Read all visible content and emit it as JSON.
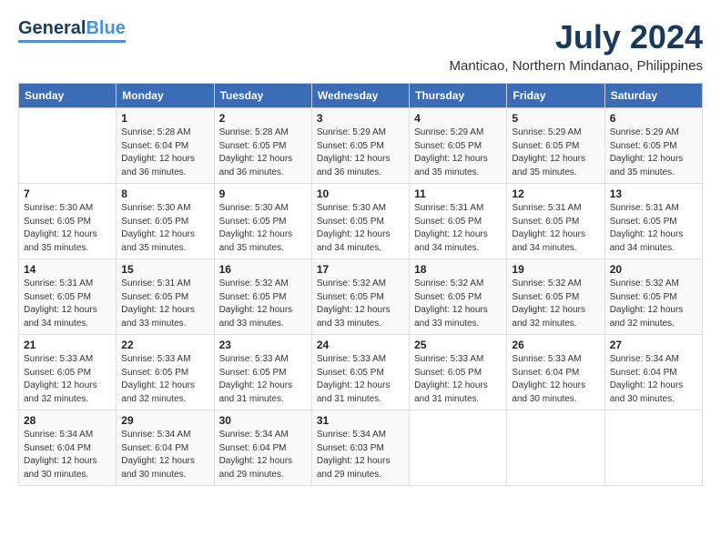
{
  "logo": {
    "general": "General",
    "blue": "Blue"
  },
  "title": {
    "month_year": "July 2024",
    "location": "Manticao, Northern Mindanao, Philippines"
  },
  "header": {
    "days": [
      "Sunday",
      "Monday",
      "Tuesday",
      "Wednesday",
      "Thursday",
      "Friday",
      "Saturday"
    ]
  },
  "weeks": [
    [
      {
        "day": "",
        "sunrise": "",
        "sunset": "",
        "daylight": ""
      },
      {
        "day": "1",
        "sunrise": "Sunrise: 5:28 AM",
        "sunset": "Sunset: 6:04 PM",
        "daylight": "Daylight: 12 hours and 36 minutes."
      },
      {
        "day": "2",
        "sunrise": "Sunrise: 5:28 AM",
        "sunset": "Sunset: 6:05 PM",
        "daylight": "Daylight: 12 hours and 36 minutes."
      },
      {
        "day": "3",
        "sunrise": "Sunrise: 5:29 AM",
        "sunset": "Sunset: 6:05 PM",
        "daylight": "Daylight: 12 hours and 36 minutes."
      },
      {
        "day": "4",
        "sunrise": "Sunrise: 5:29 AM",
        "sunset": "Sunset: 6:05 PM",
        "daylight": "Daylight: 12 hours and 35 minutes."
      },
      {
        "day": "5",
        "sunrise": "Sunrise: 5:29 AM",
        "sunset": "Sunset: 6:05 PM",
        "daylight": "Daylight: 12 hours and 35 minutes."
      },
      {
        "day": "6",
        "sunrise": "Sunrise: 5:29 AM",
        "sunset": "Sunset: 6:05 PM",
        "daylight": "Daylight: 12 hours and 35 minutes."
      }
    ],
    [
      {
        "day": "7",
        "sunrise": "Sunrise: 5:30 AM",
        "sunset": "Sunset: 6:05 PM",
        "daylight": "Daylight: 12 hours and 35 minutes."
      },
      {
        "day": "8",
        "sunrise": "Sunrise: 5:30 AM",
        "sunset": "Sunset: 6:05 PM",
        "daylight": "Daylight: 12 hours and 35 minutes."
      },
      {
        "day": "9",
        "sunrise": "Sunrise: 5:30 AM",
        "sunset": "Sunset: 6:05 PM",
        "daylight": "Daylight: 12 hours and 35 minutes."
      },
      {
        "day": "10",
        "sunrise": "Sunrise: 5:30 AM",
        "sunset": "Sunset: 6:05 PM",
        "daylight": "Daylight: 12 hours and 34 minutes."
      },
      {
        "day": "11",
        "sunrise": "Sunrise: 5:31 AM",
        "sunset": "Sunset: 6:05 PM",
        "daylight": "Daylight: 12 hours and 34 minutes."
      },
      {
        "day": "12",
        "sunrise": "Sunrise: 5:31 AM",
        "sunset": "Sunset: 6:05 PM",
        "daylight": "Daylight: 12 hours and 34 minutes."
      },
      {
        "day": "13",
        "sunrise": "Sunrise: 5:31 AM",
        "sunset": "Sunset: 6:05 PM",
        "daylight": "Daylight: 12 hours and 34 minutes."
      }
    ],
    [
      {
        "day": "14",
        "sunrise": "Sunrise: 5:31 AM",
        "sunset": "Sunset: 6:05 PM",
        "daylight": "Daylight: 12 hours and 34 minutes."
      },
      {
        "day": "15",
        "sunrise": "Sunrise: 5:31 AM",
        "sunset": "Sunset: 6:05 PM",
        "daylight": "Daylight: 12 hours and 33 minutes."
      },
      {
        "day": "16",
        "sunrise": "Sunrise: 5:32 AM",
        "sunset": "Sunset: 6:05 PM",
        "daylight": "Daylight: 12 hours and 33 minutes."
      },
      {
        "day": "17",
        "sunrise": "Sunrise: 5:32 AM",
        "sunset": "Sunset: 6:05 PM",
        "daylight": "Daylight: 12 hours and 33 minutes."
      },
      {
        "day": "18",
        "sunrise": "Sunrise: 5:32 AM",
        "sunset": "Sunset: 6:05 PM",
        "daylight": "Daylight: 12 hours and 33 minutes."
      },
      {
        "day": "19",
        "sunrise": "Sunrise: 5:32 AM",
        "sunset": "Sunset: 6:05 PM",
        "daylight": "Daylight: 12 hours and 32 minutes."
      },
      {
        "day": "20",
        "sunrise": "Sunrise: 5:32 AM",
        "sunset": "Sunset: 6:05 PM",
        "daylight": "Daylight: 12 hours and 32 minutes."
      }
    ],
    [
      {
        "day": "21",
        "sunrise": "Sunrise: 5:33 AM",
        "sunset": "Sunset: 6:05 PM",
        "daylight": "Daylight: 12 hours and 32 minutes."
      },
      {
        "day": "22",
        "sunrise": "Sunrise: 5:33 AM",
        "sunset": "Sunset: 6:05 PM",
        "daylight": "Daylight: 12 hours and 32 minutes."
      },
      {
        "day": "23",
        "sunrise": "Sunrise: 5:33 AM",
        "sunset": "Sunset: 6:05 PM",
        "daylight": "Daylight: 12 hours and 31 minutes."
      },
      {
        "day": "24",
        "sunrise": "Sunrise: 5:33 AM",
        "sunset": "Sunset: 6:05 PM",
        "daylight": "Daylight: 12 hours and 31 minutes."
      },
      {
        "day": "25",
        "sunrise": "Sunrise: 5:33 AM",
        "sunset": "Sunset: 6:05 PM",
        "daylight": "Daylight: 12 hours and 31 minutes."
      },
      {
        "day": "26",
        "sunrise": "Sunrise: 5:33 AM",
        "sunset": "Sunset: 6:04 PM",
        "daylight": "Daylight: 12 hours and 30 minutes."
      },
      {
        "day": "27",
        "sunrise": "Sunrise: 5:34 AM",
        "sunset": "Sunset: 6:04 PM",
        "daylight": "Daylight: 12 hours and 30 minutes."
      }
    ],
    [
      {
        "day": "28",
        "sunrise": "Sunrise: 5:34 AM",
        "sunset": "Sunset: 6:04 PM",
        "daylight": "Daylight: 12 hours and 30 minutes."
      },
      {
        "day": "29",
        "sunrise": "Sunrise: 5:34 AM",
        "sunset": "Sunset: 6:04 PM",
        "daylight": "Daylight: 12 hours and 30 minutes."
      },
      {
        "day": "30",
        "sunrise": "Sunrise: 5:34 AM",
        "sunset": "Sunset: 6:04 PM",
        "daylight": "Daylight: 12 hours and 29 minutes."
      },
      {
        "day": "31",
        "sunrise": "Sunrise: 5:34 AM",
        "sunset": "Sunset: 6:03 PM",
        "daylight": "Daylight: 12 hours and 29 minutes."
      },
      {
        "day": "",
        "sunrise": "",
        "sunset": "",
        "daylight": ""
      },
      {
        "day": "",
        "sunrise": "",
        "sunset": "",
        "daylight": ""
      },
      {
        "day": "",
        "sunrise": "",
        "sunset": "",
        "daylight": ""
      }
    ]
  ]
}
